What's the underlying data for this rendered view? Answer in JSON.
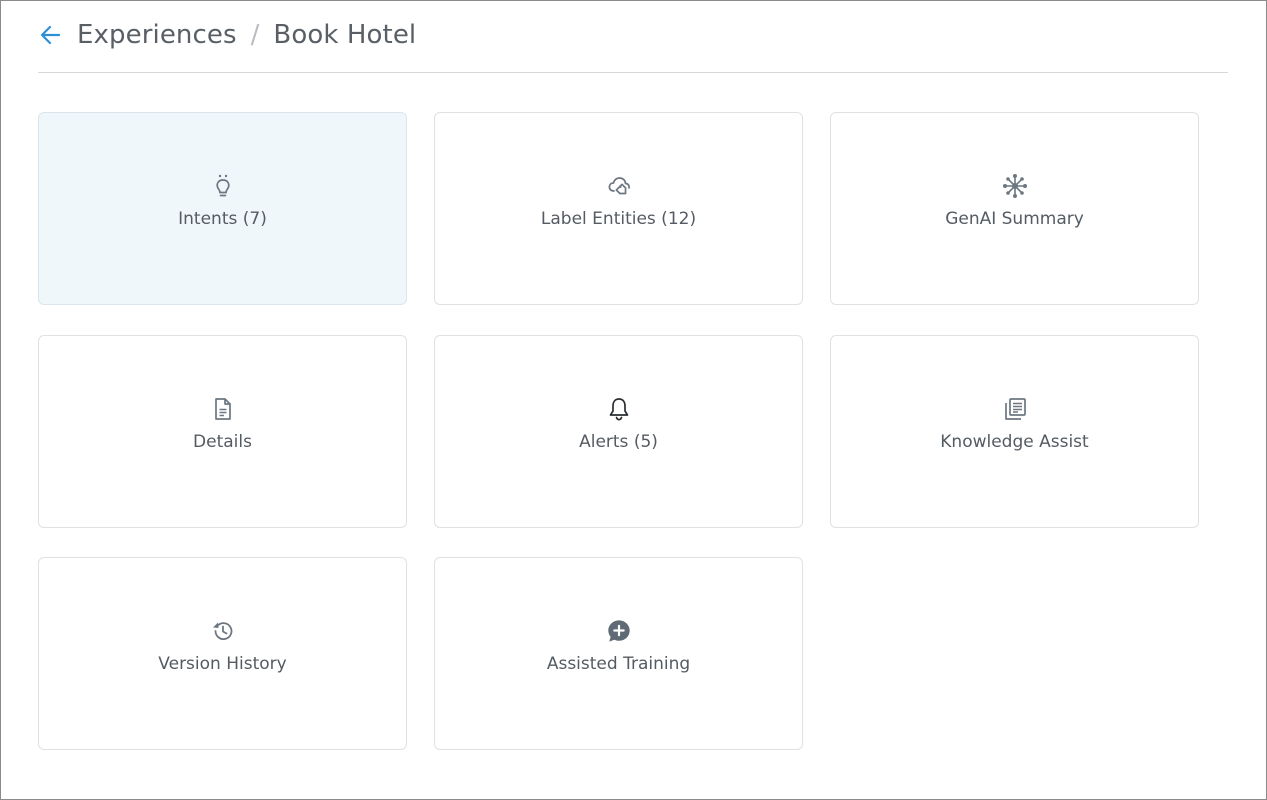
{
  "header": {
    "back_icon": "arrow-left-icon",
    "breadcrumb": [
      {
        "label": "Experiences"
      },
      {
        "label": "Book Hotel"
      }
    ],
    "separator": "/"
  },
  "colors": {
    "accent": "#2f8fd6",
    "active_card_bg": "#f0f7fb",
    "icon": "#6d7781",
    "text": "#555b62"
  },
  "cards": [
    {
      "label": "Intents (7)",
      "icon": "lightbulb-icon",
      "active": true
    },
    {
      "label": "Label Entities (12)",
      "icon": "tag-cloud-icon",
      "active": false
    },
    {
      "label": "GenAI Summary",
      "icon": "network-nodes-icon",
      "active": false
    },
    {
      "label": "Details",
      "icon": "document-icon",
      "active": false
    },
    {
      "label": "Alerts (5)",
      "icon": "bell-icon",
      "active": false
    },
    {
      "label": "Knowledge Assist",
      "icon": "library-books-icon",
      "active": false
    },
    {
      "label": "Version History",
      "icon": "history-icon",
      "active": false
    },
    {
      "label": "Assisted Training",
      "icon": "chat-plus-icon",
      "active": false
    }
  ]
}
